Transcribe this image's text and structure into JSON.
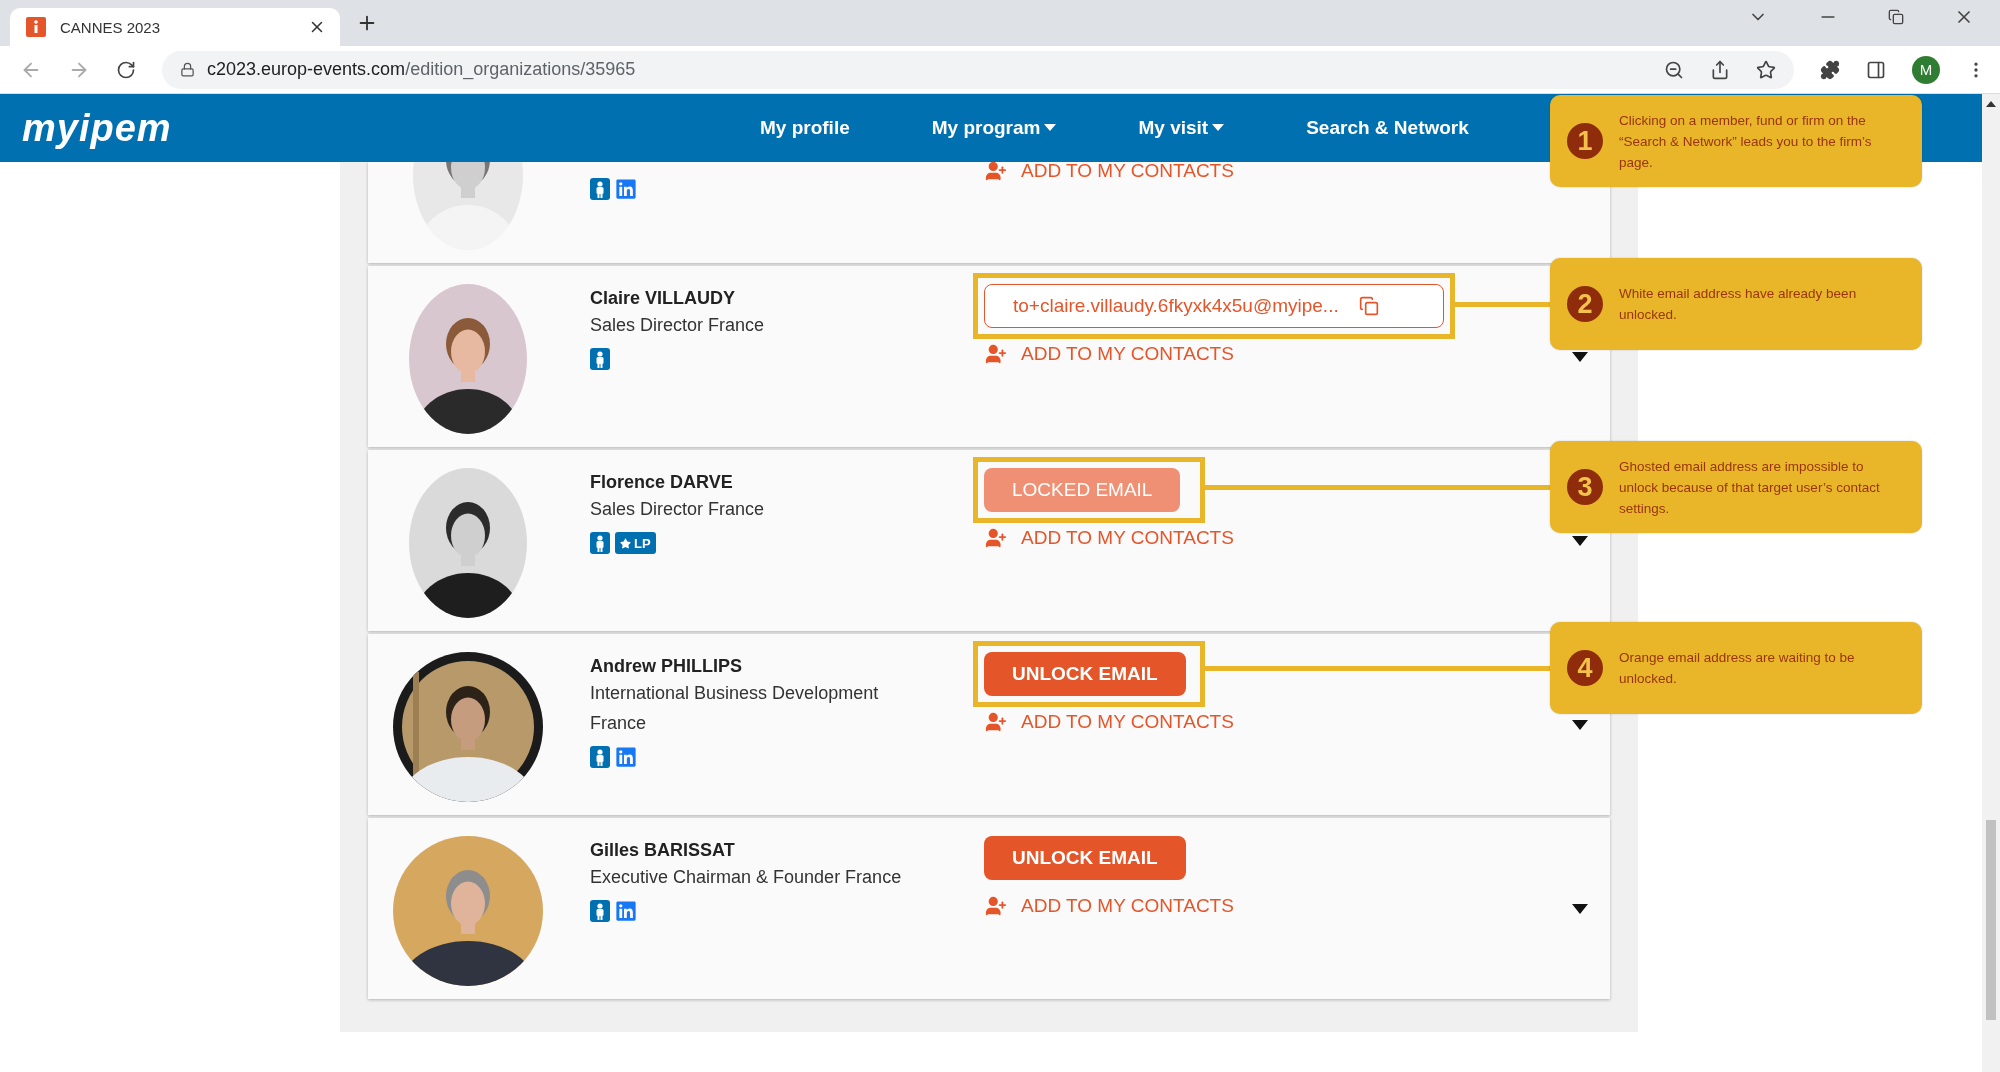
{
  "browser": {
    "tab_title": "CANNES 2023",
    "url_host": "c2023.europ-events.com",
    "url_path": "/edition_organizations/35965",
    "profile_initial": "M"
  },
  "site": {
    "logo": "myipem",
    "nav": [
      {
        "label": "My profile",
        "dropdown": false
      },
      {
        "label": "My program",
        "dropdown": true
      },
      {
        "label": "My visit",
        "dropdown": true
      },
      {
        "label": "Search & Network",
        "dropdown": false
      }
    ]
  },
  "contacts": [
    {
      "kind": "partial",
      "badges": [
        {
          "kind": "member"
        },
        {
          "kind": "linkedin"
        }
      ],
      "add_contact": "ADD TO MY CONTACTS"
    },
    {
      "kind": "full",
      "name": "Claire VILLAUDY",
      "title": "Sales Director France",
      "badges": [
        {
          "kind": "member"
        }
      ],
      "email": {
        "kind": "address",
        "text": "to+claire.villaudy.6fkyxk4x5u@myipe..."
      },
      "highlighted": true,
      "add_contact": "ADD TO MY CONTACTS"
    },
    {
      "kind": "full",
      "name": "Florence DARVE",
      "title": "Sales Director France",
      "badges": [
        {
          "kind": "member"
        },
        {
          "kind": "lp",
          "label": "LP"
        }
      ],
      "email": {
        "kind": "locked",
        "text": "LOCKED EMAIL"
      },
      "highlighted": true,
      "add_contact": "ADD TO MY CONTACTS"
    },
    {
      "kind": "full",
      "name": "Andrew PHILLIPS",
      "title": "International Business Development France",
      "badges": [
        {
          "kind": "member"
        },
        {
          "kind": "linkedin"
        }
      ],
      "email": {
        "kind": "unlock",
        "text": "UNLOCK EMAIL"
      },
      "highlighted": true,
      "add_contact": "ADD TO MY CONTACTS"
    },
    {
      "kind": "full",
      "name": "Gilles BARISSAT",
      "title": "Executive Chairman & Founder France",
      "badges": [
        {
          "kind": "member"
        },
        {
          "kind": "linkedin"
        }
      ],
      "email": {
        "kind": "unlock",
        "text": "UNLOCK EMAIL"
      },
      "highlighted": false,
      "add_contact": "ADD TO MY CONTACTS"
    }
  ],
  "callouts": [
    {
      "number": "1",
      "text": "Clicking on a member, fund or firm on the “Search & Network” leads you to the firm’s page."
    },
    {
      "number": "2",
      "text": "White email address have already been unlocked."
    },
    {
      "number": "3",
      "text": "Ghosted email address are impossible to unlock because of that target user’s contact settings."
    },
    {
      "number": "4",
      "text": "Orange email address are waiting to be unlocked."
    }
  ]
}
